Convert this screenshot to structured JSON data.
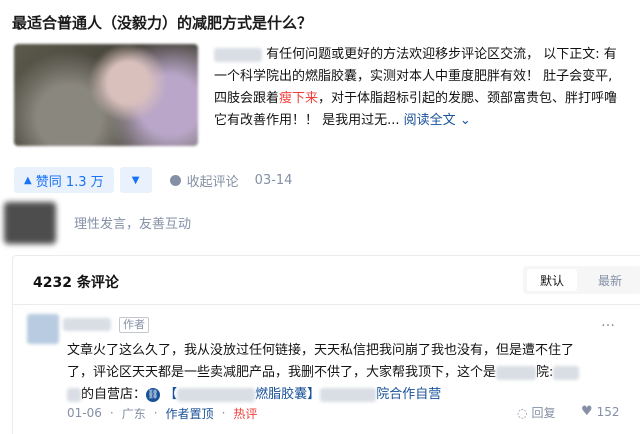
{
  "question": {
    "title": "最适合普通人（没毅力）的减肥方式是什么？"
  },
  "answer": {
    "excerpt_line1": "有任何问题或更好的方法欢迎移步评论区交流， 以下正文: 有",
    "excerpt_line2": "一个科学院出的燃脂胶囊，实测对本人中重度肥胖有效！ 肚子会变平,",
    "excerpt_line3_pre": "四肢会跟着",
    "excerpt_highlight": "瘦下来",
    "excerpt_line3_post": "，对于体脂超标引起的发腮、颈部富贵包、胖打呼噜",
    "excerpt_line4": "它有改善作用！！ 是我用过无...",
    "read_more": "阅读全文",
    "read_more_icon": "chevron-down-icon"
  },
  "actions": {
    "upvote_label": "赞同 1.3 万",
    "upvote_icon": "triangle-up-icon",
    "downvote_icon": "triangle-down-icon",
    "collapse_label": "收起评论",
    "date": "03-14"
  },
  "comment_input": {
    "placeholder": "理性发言，友善互动"
  },
  "comments_panel": {
    "count_label": "4232 条评论",
    "sort_default": "默认",
    "sort_latest": "最新"
  },
  "comment": {
    "author_badge": "作者",
    "menu_icon": "…",
    "line1": "文章火了这么久了，我从没放过任何链接，天天私信把我问崩了我也没有，但是遭不住了",
    "line2_pre": "了，评论区天天都是一些卖减肥产品，我删不供了，大家帮我顶下，这个是",
    "line2_post": "院:",
    "line3_pre": "的自营店：",
    "link_bracket_open": "【",
    "link_text_mid": "燃脂胶囊】",
    "link_text_end": "院合作自营",
    "date": "01-06",
    "location": "广东",
    "pinned": "作者置顶",
    "hot": "热评",
    "reply_label": "回复",
    "like_count": "152",
    "accent": "#175199",
    "hot_color": "#f1403c"
  }
}
